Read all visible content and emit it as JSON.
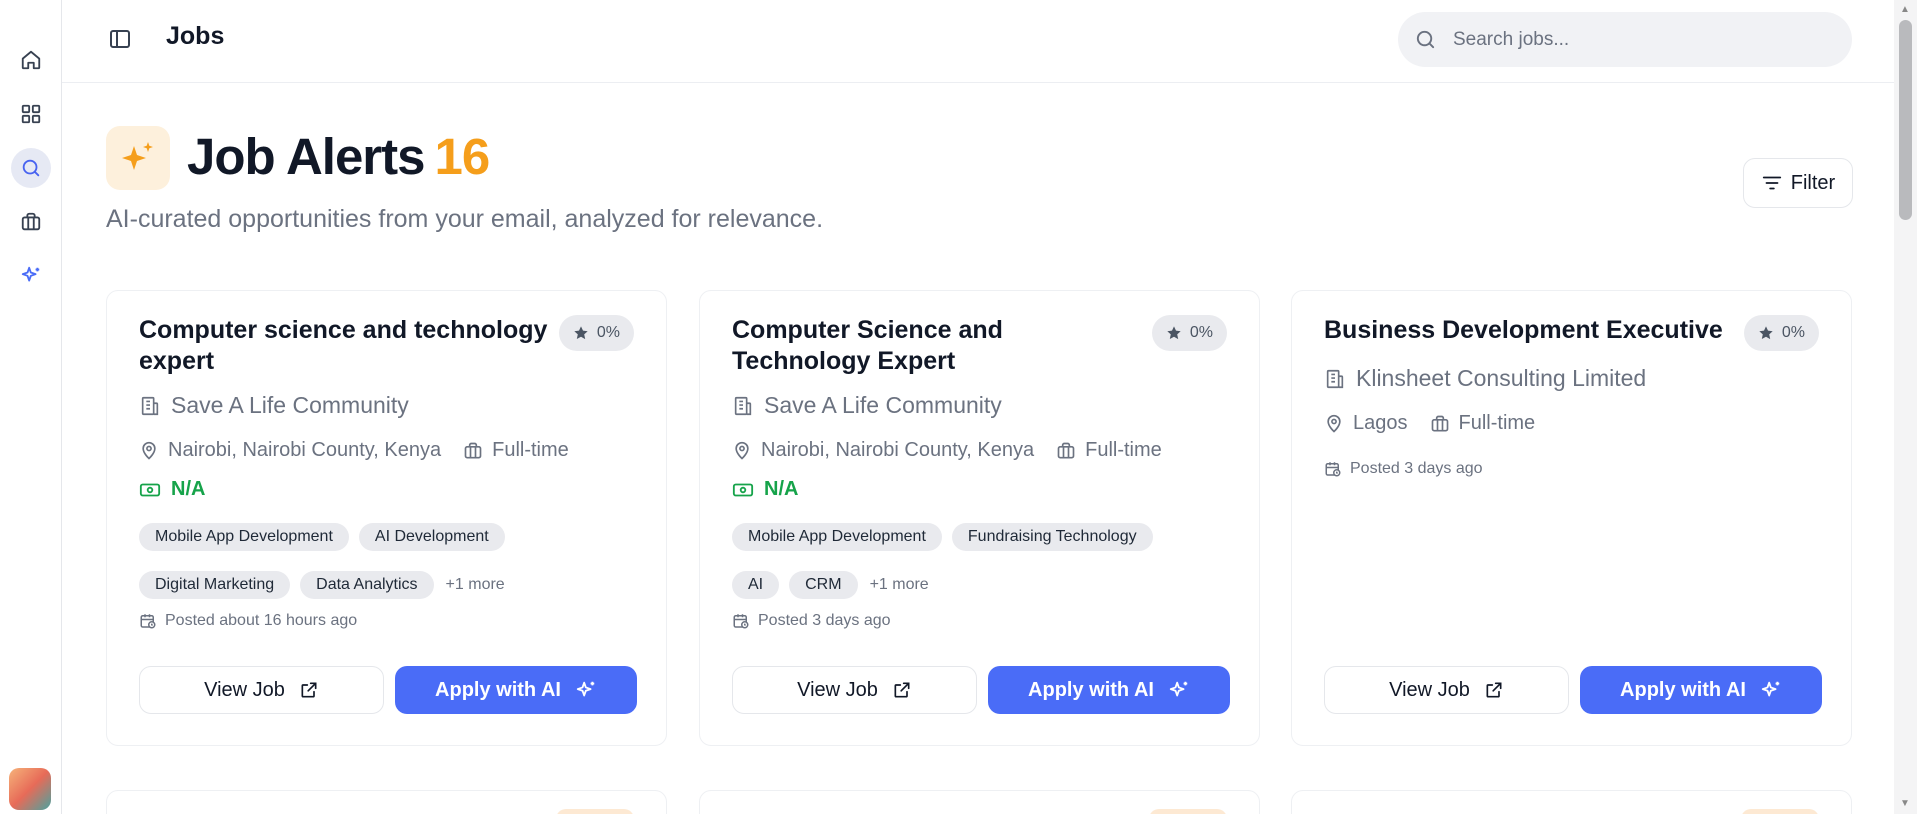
{
  "header": {
    "title": "Jobs",
    "search_placeholder": "Search jobs..."
  },
  "rail": {
    "items": [
      {
        "icon": "home-icon"
      },
      {
        "icon": "grid-icon"
      },
      {
        "icon": "search-icon",
        "active": true
      },
      {
        "icon": "briefcase-icon"
      },
      {
        "icon": "sparkle-icon"
      }
    ]
  },
  "hero": {
    "title": "Job Alerts",
    "count": "16",
    "subtitle": "AI-curated opportunities from your email, analyzed for relevance.",
    "filter_label": "Filter"
  },
  "colors": {
    "accent": "#4a6cf7",
    "count": "#f59e1b",
    "salary": "#16a34a"
  },
  "jobs": [
    {
      "title": "Computer science and technology expert",
      "score": "0%",
      "company": "Save A Life Community",
      "location": "Nairobi, Nairobi County, Kenya",
      "type": "Full-time",
      "salary": "N/A",
      "tags": [
        "Mobile App Development",
        "AI Development",
        "Digital Marketing",
        "Data Analytics"
      ],
      "more": "+1 more",
      "posted": "Posted about 16 hours ago",
      "view_label": "View Job",
      "apply_label": "Apply with AI"
    },
    {
      "title": "Computer Science and Technology Expert",
      "score": "0%",
      "company": "Save A Life Community",
      "location": "Nairobi, Nairobi County, Kenya",
      "type": "Full-time",
      "salary": "N/A",
      "tags": [
        "Mobile App Development",
        "Fundraising Technology",
        "AI",
        "CRM"
      ],
      "more": "+1 more",
      "posted": "Posted 3 days ago",
      "view_label": "View Job",
      "apply_label": "Apply with AI"
    },
    {
      "title": "Business Development Executive",
      "score": "0%",
      "company": "Klinsheet Consulting Limited",
      "location": "Lagos",
      "type": "Full-time",
      "posted": "Posted 3 days ago",
      "view_label": "View Job",
      "apply_label": "Apply with AI"
    }
  ]
}
